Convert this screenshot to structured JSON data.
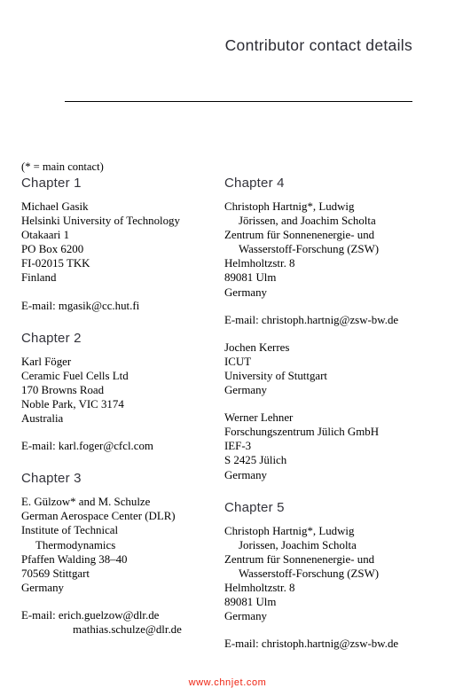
{
  "header": {
    "title": "Contributor contact details"
  },
  "note": "(* = main contact)",
  "watermark": "www.chnjet.com",
  "columns": {
    "left": [
      {
        "heading": "Chapter 1",
        "blocks": [
          {
            "lines": [
              {
                "text": "Michael Gasik",
                "indent": 0
              },
              {
                "text": "Helsinki University of Technology",
                "indent": 0
              },
              {
                "text": "Otakaari 1",
                "indent": 0
              },
              {
                "text": "PO Box 6200",
                "indent": 0
              },
              {
                "text": "FI-02015 TKK",
                "indent": 0
              },
              {
                "text": "Finland",
                "indent": 0
              }
            ]
          },
          {
            "lines": [
              {
                "text": "E-mail: mgasik@cc.hut.fi",
                "indent": 0
              }
            ]
          }
        ]
      },
      {
        "heading": "Chapter 2",
        "blocks": [
          {
            "lines": [
              {
                "text": "Karl Föger",
                "indent": 0
              },
              {
                "text": "Ceramic Fuel Cells Ltd",
                "indent": 0
              },
              {
                "text": "170 Browns Road",
                "indent": 0
              },
              {
                "text": "Noble Park, VIC 3174",
                "indent": 0
              },
              {
                "text": "Australia",
                "indent": 0
              }
            ]
          },
          {
            "lines": [
              {
                "text": "E-mail: karl.foger@cfcl.com",
                "indent": 0
              }
            ]
          }
        ]
      },
      {
        "heading": "Chapter 3",
        "blocks": [
          {
            "lines": [
              {
                "text": "E. Gülzow* and M. Schulze",
                "indent": 0
              },
              {
                "text": "German Aerospace Center (DLR)",
                "indent": 0
              },
              {
                "text": "Institute of Technical",
                "indent": 0
              },
              {
                "text": "Thermodynamics",
                "indent": 1
              },
              {
                "text": "Pfaffen Walding 38–40",
                "indent": 0
              },
              {
                "text": "70569 Stittgart",
                "indent": 0
              },
              {
                "text": "Germany",
                "indent": 0
              }
            ]
          },
          {
            "lines": [
              {
                "text": "E-mail: erich.guelzow@dlr.de",
                "indent": 0
              },
              {
                "text": "mathias.schulze@dlr.de",
                "indent": 2
              }
            ]
          }
        ]
      }
    ],
    "right": [
      {
        "heading": "Chapter 4",
        "blocks": [
          {
            "lines": [
              {
                "text": "Christoph Hartnig*, Ludwig",
                "indent": 0
              },
              {
                "text": "Jörissen, and Joachim Scholta",
                "indent": 1
              },
              {
                "text": "Zentrum für Sonnenenergie- und",
                "indent": 0
              },
              {
                "text": "Wasserstoff-Forschung (ZSW)",
                "indent": 1
              },
              {
                "text": "Helmholtzstr. 8",
                "indent": 0
              },
              {
                "text": "89081 Ulm",
                "indent": 0
              },
              {
                "text": "Germany",
                "indent": 0
              }
            ]
          },
          {
            "lines": [
              {
                "text": "E-mail: christoph.hartnig@zsw-bw.de",
                "indent": 0
              }
            ]
          },
          {
            "lines": [
              {
                "text": "Jochen Kerres",
                "indent": 0
              },
              {
                "text": "ICUT",
                "indent": 0
              },
              {
                "text": "University of Stuttgart",
                "indent": 0
              },
              {
                "text": "Germany",
                "indent": 0
              }
            ]
          },
          {
            "lines": [
              {
                "text": "Werner Lehner",
                "indent": 0
              },
              {
                "text": "Forschungszentrum Jülich GmbH",
                "indent": 0
              },
              {
                "text": "IEF-3",
                "indent": 0
              },
              {
                "text": "S 2425 Jülich",
                "indent": 0
              },
              {
                "text": "Germany",
                "indent": 0
              }
            ]
          }
        ]
      },
      {
        "heading": "Chapter 5",
        "blocks": [
          {
            "lines": [
              {
                "text": "Christoph Hartnig*, Ludwig",
                "indent": 0
              },
              {
                "text": "Jorissen, Joachim Scholta",
                "indent": 1
              },
              {
                "text": "Zentrum für Sonnenenergie- und",
                "indent": 0
              },
              {
                "text": "Wasserstoff-Forschung (ZSW)",
                "indent": 1
              },
              {
                "text": "Helmholtzstr. 8",
                "indent": 0
              },
              {
                "text": "89081 Ulm",
                "indent": 0
              },
              {
                "text": "Germany",
                "indent": 0
              }
            ]
          },
          {
            "lines": [
              {
                "text": "E-mail: christoph.hartnig@zsw-bw.de",
                "indent": 0
              }
            ]
          }
        ]
      }
    ]
  }
}
